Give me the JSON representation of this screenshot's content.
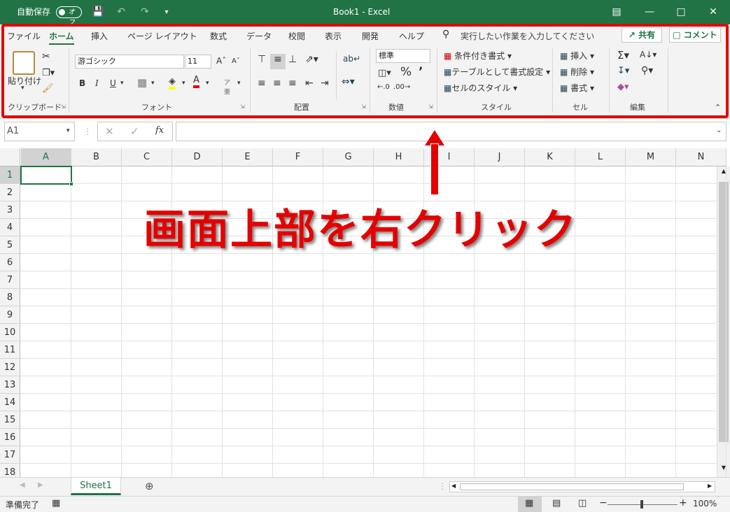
{
  "titlebar": {
    "autosave_label": "自動保存",
    "autosave_state": "オフ",
    "doc_title": "Book1  -  Excel"
  },
  "tabs": [
    "ファイル",
    "ホーム",
    "挿入",
    "ページ レイアウト",
    "数式",
    "データ",
    "校閲",
    "表示",
    "開発",
    "ヘルプ"
  ],
  "search": {
    "placeholder": "実行したい作業を入力してください"
  },
  "share_label": "共有",
  "comment_label": "コメント",
  "clipboard": {
    "paste": "貼り付け",
    "label": "クリップボード"
  },
  "font": {
    "name": "游ゴシック",
    "size": "11",
    "label": "フォント",
    "bold": "B",
    "italic": "I",
    "underline": "U"
  },
  "alignment": {
    "label": "配置"
  },
  "number": {
    "format": "標準",
    "label": "数値"
  },
  "styles": {
    "conditional": "条件付き書式",
    "table": "テーブルとして書式設定",
    "cell_styles": "セルのスタイル",
    "label": "スタイル"
  },
  "cells": {
    "insert": "挿入",
    "delete": "削除",
    "format": "書式",
    "label": "セル"
  },
  "editing": {
    "label": "編集"
  },
  "namebox": "A1",
  "fx": "fx",
  "columns": [
    "A",
    "B",
    "C",
    "D",
    "E",
    "F",
    "G",
    "H",
    "I",
    "J",
    "K",
    "L",
    "M",
    "N"
  ],
  "rows": [
    "1",
    "2",
    "3",
    "4",
    "5",
    "6",
    "7",
    "8",
    "9",
    "10",
    "11",
    "12",
    "13",
    "14",
    "15",
    "16",
    "17",
    "18"
  ],
  "sheet_tab": "Sheet1",
  "status": {
    "ready": "準備完了",
    "zoom": "100%"
  },
  "annotation": "画面上部を右クリック",
  "colors": {
    "excel_green": "#217346",
    "annotation_red": "#e50000"
  }
}
